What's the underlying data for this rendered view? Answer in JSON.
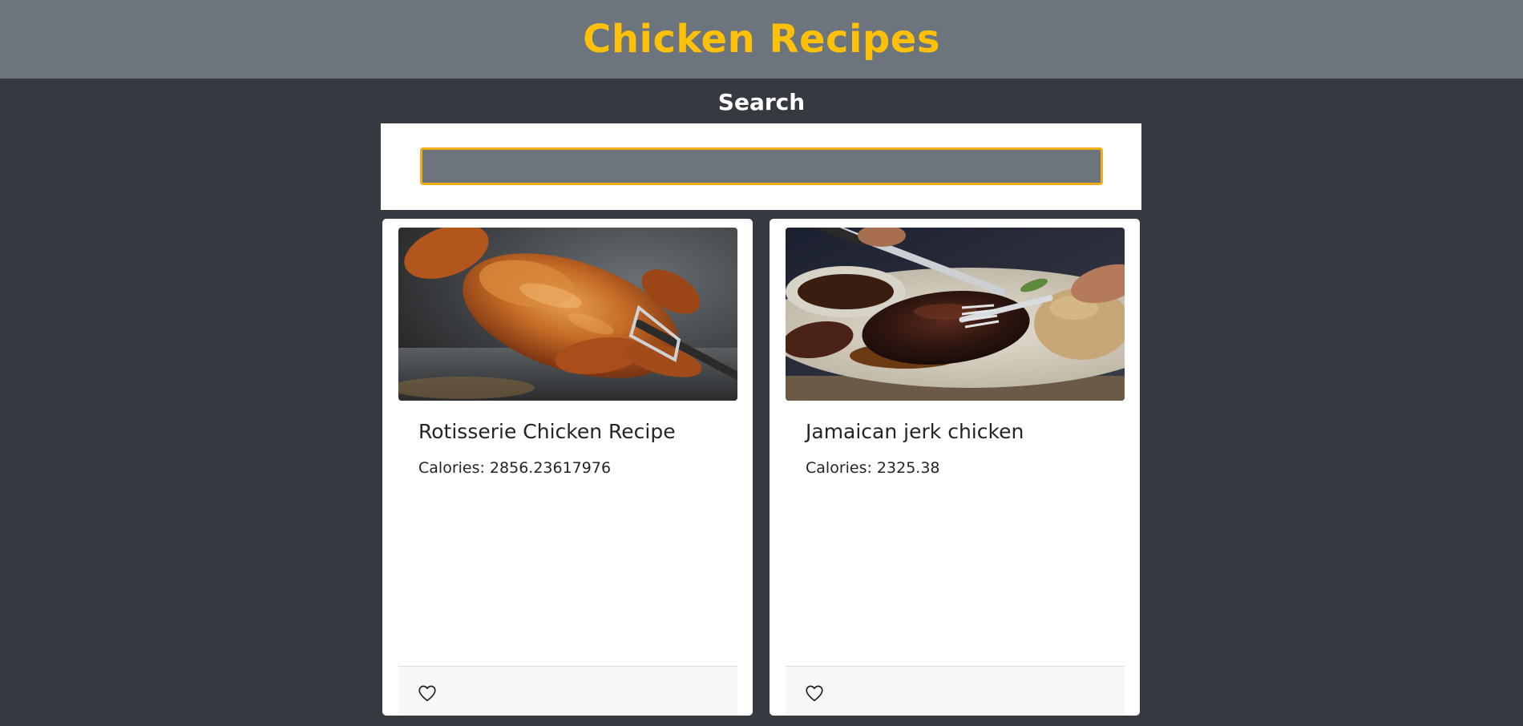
{
  "header": {
    "title": "Chicken Recipes"
  },
  "search": {
    "heading": "Search",
    "value": "",
    "placeholder": ""
  },
  "recipes": [
    {
      "title": "Rotisserie Chicken Recipe",
      "calories": "Calories: 2856.23617976",
      "image_icon": "rotisserie-chicken-photo",
      "favorite_icon": "heart-outline-icon"
    },
    {
      "title": "Jamaican jerk chicken",
      "calories": "Calories: 2325.38",
      "image_icon": "jerk-chicken-photo",
      "favorite_icon": "heart-outline-icon"
    }
  ],
  "colors": {
    "header_bg": "#6c757d",
    "page_bg": "#343a40",
    "accent": "#ffc107",
    "input_border": "#f0ad1a"
  }
}
